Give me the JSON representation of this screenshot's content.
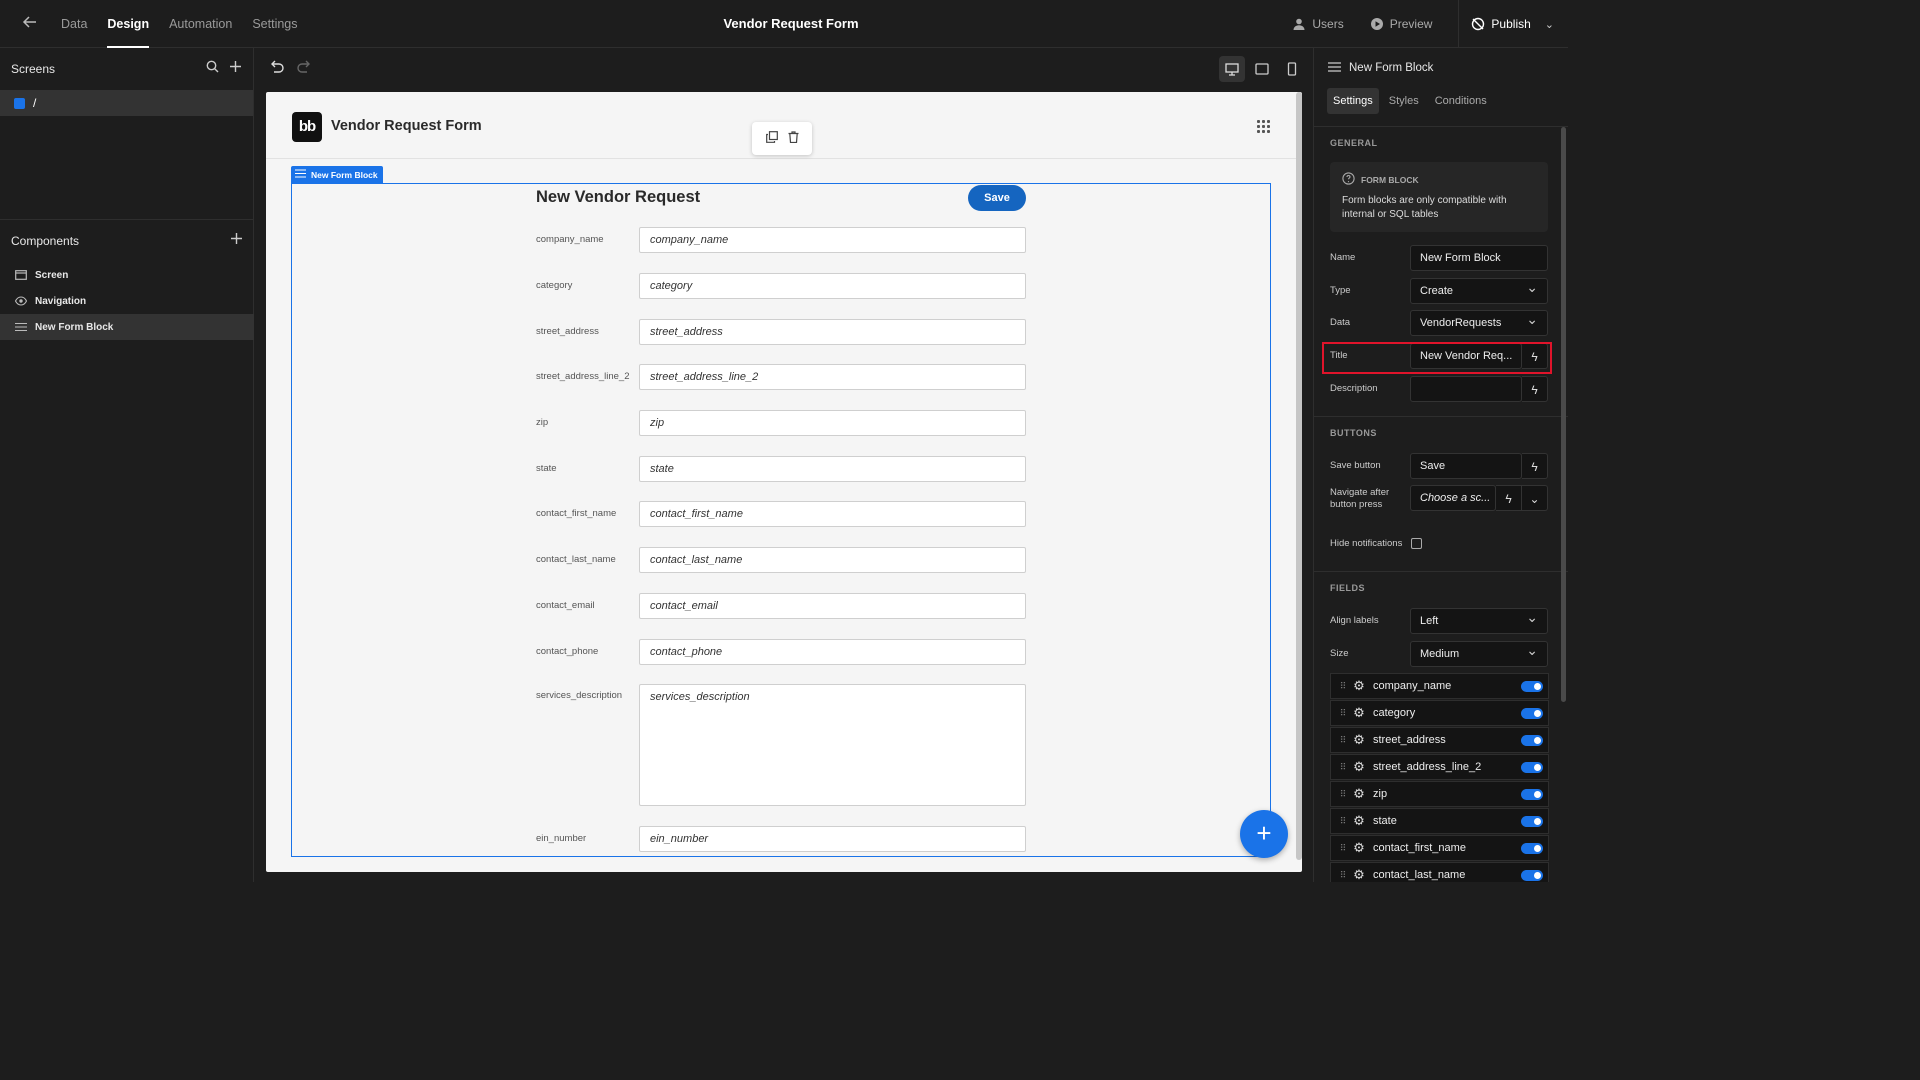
{
  "topbar": {
    "tabs": [
      {
        "label": "Data"
      },
      {
        "label": "Design"
      },
      {
        "label": "Automation"
      },
      {
        "label": "Settings"
      }
    ],
    "app_title": "Vendor Request Form",
    "users_label": "Users",
    "preview_label": "Preview",
    "publish_label": "Publish"
  },
  "left": {
    "screens_title": "Screens",
    "screen_route": "/",
    "components_title": "Components",
    "components": [
      {
        "label": "Screen",
        "icon": "screen-icon"
      },
      {
        "label": "Navigation",
        "icon": "eye-icon"
      },
      {
        "label": "New Form Block",
        "icon": "form-block-icon"
      }
    ]
  },
  "canvas": {
    "app_title": "Vendor Request Form",
    "logo_text": "bb",
    "block_tag": "New Form Block",
    "form_title": "New Vendor Request",
    "save_label": "Save",
    "fields": [
      {
        "label": "company_name",
        "placeholder": "company_name"
      },
      {
        "label": "category",
        "placeholder": "category"
      },
      {
        "label": "street_address",
        "placeholder": "street_address"
      },
      {
        "label": "street_address_line_2",
        "placeholder": "street_address_line_2"
      },
      {
        "label": "zip",
        "placeholder": "zip"
      },
      {
        "label": "state",
        "placeholder": "state"
      },
      {
        "label": "contact_first_name",
        "placeholder": "contact_first_name"
      },
      {
        "label": "contact_last_name",
        "placeholder": "contact_last_name"
      },
      {
        "label": "contact_email",
        "placeholder": "contact_email"
      },
      {
        "label": "contact_phone",
        "placeholder": "contact_phone"
      },
      {
        "label": "services_description",
        "placeholder": "services_description"
      },
      {
        "label": "ein_number",
        "placeholder": "ein_number"
      }
    ]
  },
  "right": {
    "title": "New Form Block",
    "tabs": [
      {
        "label": "Settings"
      },
      {
        "label": "Styles"
      },
      {
        "label": "Conditions"
      }
    ],
    "general_title": "GENERAL",
    "info_title": "FORM BLOCK",
    "info_body": "Form blocks are only compatible with internal or SQL tables",
    "props": {
      "name": {
        "label": "Name",
        "value": "New Form Block"
      },
      "type": {
        "label": "Type",
        "value": "Create"
      },
      "data": {
        "label": "Data",
        "value": "VendorRequests"
      },
      "title": {
        "label": "Title",
        "value": "New Vendor Req..."
      },
      "description": {
        "label": "Description",
        "value": ""
      }
    },
    "buttons_title": "BUTTONS",
    "save_button": {
      "label": "Save button",
      "value": "Save"
    },
    "navigate": {
      "label_1": "Navigate after",
      "label_2": "button press",
      "value": "Choose a sc..."
    },
    "hide_notifications_label": "Hide notifications",
    "fields_title": "FIELDS",
    "align_labels": {
      "label": "Align labels",
      "value": "Left"
    },
    "size": {
      "label": "Size",
      "value": "Medium"
    },
    "field_list": [
      {
        "name": "company_name"
      },
      {
        "name": "category"
      },
      {
        "name": "street_address"
      },
      {
        "name": "street_address_line_2"
      },
      {
        "name": "zip"
      },
      {
        "name": "state"
      },
      {
        "name": "contact_first_name"
      },
      {
        "name": "contact_last_name"
      }
    ]
  },
  "colors": {
    "accent": "#1a73e8",
    "highlight": "#e0142b"
  }
}
